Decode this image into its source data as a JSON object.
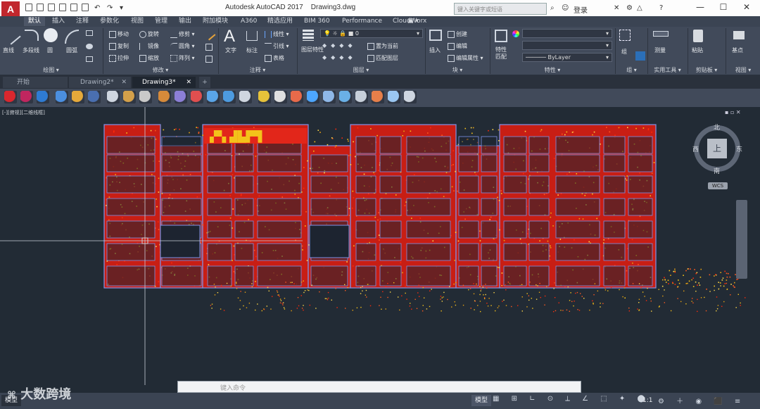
{
  "app": {
    "title": "Autodesk AutoCAD 2017",
    "file": "Drawing3.dwg",
    "app_button": "A",
    "search_placeholder": "键入关键字或短语",
    "login": "登录"
  },
  "ribbon_tabs": [
    "默认",
    "插入",
    "注释",
    "参数化",
    "视图",
    "管理",
    "输出",
    "附加模块",
    "A360",
    "精选应用",
    "BIM 360",
    "Performance",
    "CloudWorx"
  ],
  "ribbon": {
    "draw": {
      "line": "直线",
      "polyline": "多段线",
      "circle": "圆",
      "arc": "圆弧",
      "panel": "绘图"
    },
    "modify": {
      "move": "移动",
      "rotate": "旋转",
      "trim": "修剪",
      "copy": "复制",
      "mirror": "镜像",
      "fillet": "圆角",
      "stretch": "拉伸",
      "scale": "缩放",
      "array": "阵列",
      "panel": "修改"
    },
    "annotation": {
      "text": "文字",
      "dimension": "标注",
      "linear": "线性",
      "leader": "引线",
      "table": "表格",
      "panel": "注释"
    },
    "layers": {
      "layer_props": "图层特性",
      "current_layer": "0",
      "set_current": "置为当前",
      "match_layer": "匹配图层",
      "panel": "图层"
    },
    "block": {
      "insert": "插入",
      "create": "创建",
      "edit": "编辑",
      "edit_attr": "编辑属性",
      "panel": "块"
    },
    "properties": {
      "match": "特性匹配",
      "bylayer": "ByLayer",
      "panel": "特性"
    },
    "groups": {
      "group": "组",
      "panel": "组"
    },
    "utilities": {
      "measure": "测量",
      "panel": "实用工具"
    },
    "clipboard": {
      "paste": "粘贴",
      "panel": "剪贴板"
    },
    "view": {
      "base": "基点",
      "panel": "视图"
    }
  },
  "doc_tabs": [
    "开始",
    "Drawing2*",
    "Drawing3*"
  ],
  "viewport": {
    "label": "[-][俯视][二维线框]"
  },
  "navcube": {
    "north": "北",
    "south": "南",
    "east": "东",
    "west": "西",
    "top": "上",
    "wcs": "WCS"
  },
  "command": {
    "placeholder": "键入命令"
  },
  "status": {
    "model": "模型",
    "scale": "1:1"
  },
  "watermark": "大数跨境",
  "colors": {
    "ribbon": "#414a5a",
    "canvas": "#222b35",
    "accent": "#c1272d",
    "outline": "#7f93e8"
  }
}
